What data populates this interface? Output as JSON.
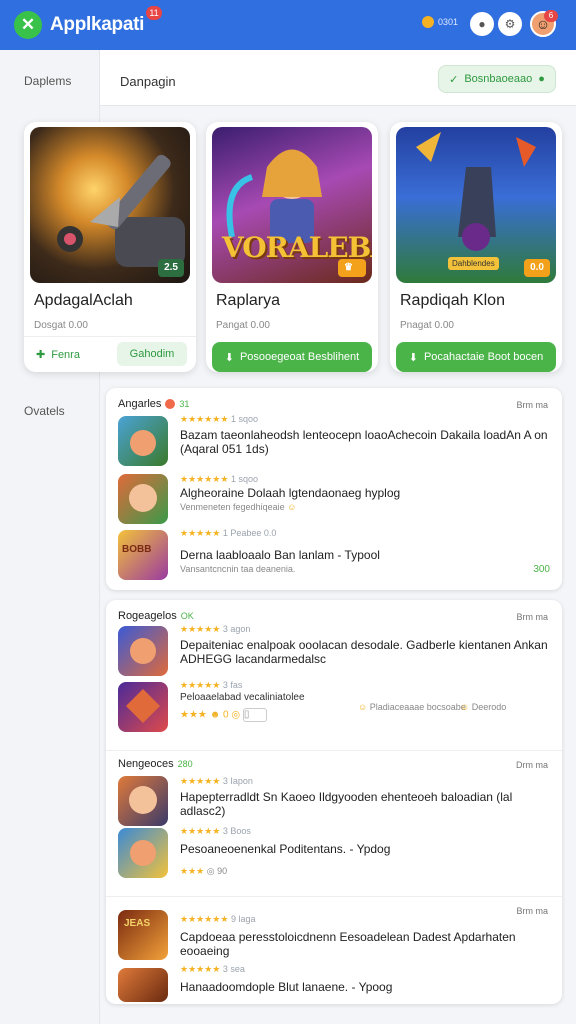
{
  "header": {
    "app_name": "Applkapati",
    "notif_count": "11",
    "coins_label": "0301",
    "avatar_badge": "6",
    "colors": {
      "bar": "#2f6fe0",
      "accent": "#4bb449"
    },
    "icons": [
      "logo-icon",
      "coin-icon",
      "friends-icon",
      "settings-icon",
      "avatar-icon"
    ]
  },
  "sidebar": {
    "item1": "Daplems",
    "item2": "Ovatels"
  },
  "main": {
    "title": "Danpagin",
    "action_button": "Bosnbaoeaao"
  },
  "featured": [
    {
      "title": "ApdagalAclah",
      "subtitle": "Dosgat 0.00",
      "badge": "2.5",
      "btn1": "Fenra",
      "btn2": "Gahodim"
    },
    {
      "title": "Raplarya",
      "subtitle": "Pangat 0.00",
      "badge": "",
      "img_text": "VORALEBA",
      "btn1": "Posooegeoat Besblihent"
    },
    {
      "title": "Rapdiqah Klon",
      "subtitle": "Pnagat 0.00",
      "badge": "0.0",
      "img_text": "Dahblendes",
      "btn1": "Pocahactaie Boot bocen"
    }
  ],
  "panel1": {
    "title": "Angarles",
    "tag": "31",
    "more": "Brm ma",
    "rows": [
      {
        "stars": "★★★★★★",
        "meta": "1 sqoo",
        "title": "Bazam taeonlaheodsh lenteocepn loaoAchecoin Dakaila loadAn A on (Aqaral 051 1ds)",
        "sub": "",
        "price": ""
      },
      {
        "stars": "★★★★★★",
        "meta": "1 sqoo",
        "title": "Algheoraine Dolaah lgtendaonaeg hyplog",
        "sub": "Venmeneten fegedhiqeaie",
        "price": ""
      },
      {
        "stars": "★★★★★",
        "meta": "1 Peabee 0.0",
        "title": "Derna laabloaalo Ban lanlam - Typool",
        "sub": "Vansantcncnin taa deanenia.",
        "price": "300"
      }
    ]
  },
  "panel2": {
    "title": "Rogeagelos",
    "tag": "OK",
    "more": "Brm ma",
    "rows": [
      {
        "stars": "★★★★★",
        "meta": "3 agon",
        "title": "Depaiteniac enalpoak ooolacan desodale. Gadberle kientanen Ankan ADHEGG lacandarmedalsc",
        "sub": ""
      },
      {
        "stars": "★★★★★",
        "meta": "3 fas",
        "title": "Peloaaelabad vecaliniatolee",
        "sub": "",
        "extra": [
          "Pladiaceaaae bocsoabe",
          "Deerodo"
        ]
      }
    ]
  },
  "panel3": {
    "title": "Nengeoces",
    "tag": "280",
    "more": "Drm ma",
    "rows": [
      {
        "stars": "★★★★★",
        "meta": "3 Iapon",
        "title": "Hapepterradldt Sn Kaoeo Ildgyooden ehenteoeh baloadian (lal adlasc2)",
        "sub": ""
      },
      {
        "stars": "★★★★★",
        "meta": "3 Boos",
        "title": "Pesoaneoenenkal Poditentans. - Ypdog",
        "sub": "90"
      }
    ]
  },
  "panel4": {
    "more": "Brm ma",
    "rows": [
      {
        "stars": "★★★★★★",
        "meta": "9 laga",
        "title": "Capdoeaa peresstoloicdnenn Eesoadelean Dadest Apdarhaten eooaeing",
        "sub": ""
      },
      {
        "stars": "★★★★★",
        "meta": "3 sea",
        "title": "Hanaadoomdople Blut lanaene. - Ypoog",
        "sub": ""
      }
    ]
  }
}
